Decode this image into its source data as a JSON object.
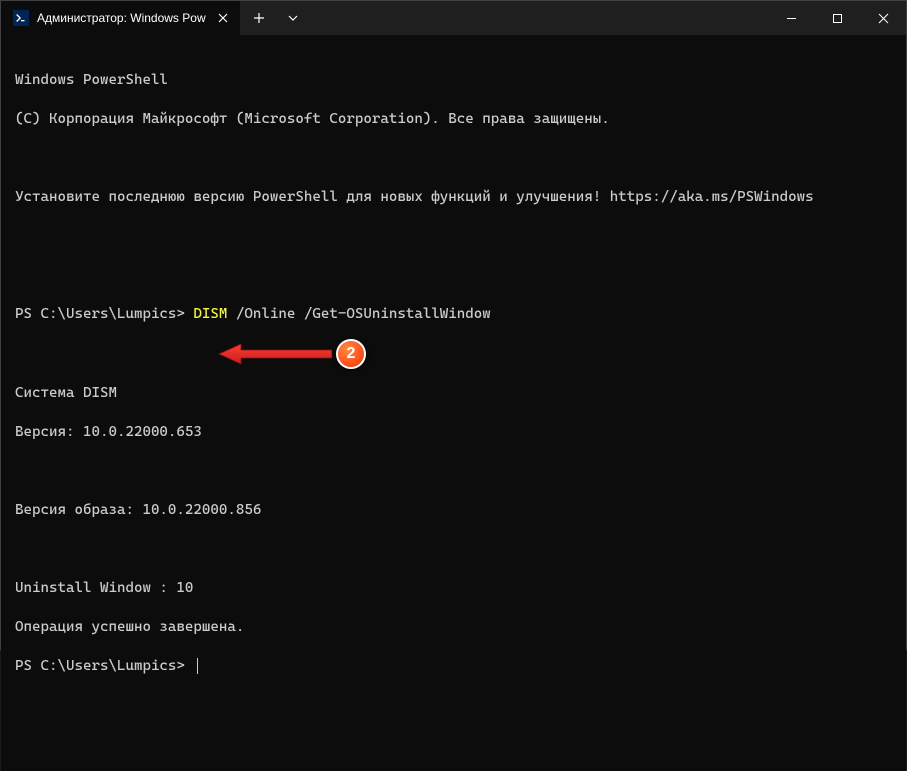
{
  "titlebar": {
    "tab_title": "Администратор: Windows Pow",
    "tab_icon_label": "PS"
  },
  "terminal": {
    "header1": "Windows PowerShell",
    "header2": "(C) Корпорация Майкрософт (Microsoft Corporation). Все права защищены.",
    "install_msg": "Установите последнюю версию PowerShell для новых функций и улучшения! https://aka.ms/PSWindows",
    "prompt1": "PS C:\\Users\\Lumpics> ",
    "command": "DISM",
    "args": " /Online /Get-OSUninstallWindow",
    "system_line": "Система DISM",
    "version_line": "Версия: 10.0.22000.653",
    "image_version_line": "Версия образа: 10.0.22000.856",
    "uninstall_window_line": "Uninstall Window : 10",
    "success_line": "Операция успешно завершена.",
    "prompt2": "PS C:\\Users\\Lumpics> "
  },
  "annotation": {
    "badge_number": "2"
  }
}
